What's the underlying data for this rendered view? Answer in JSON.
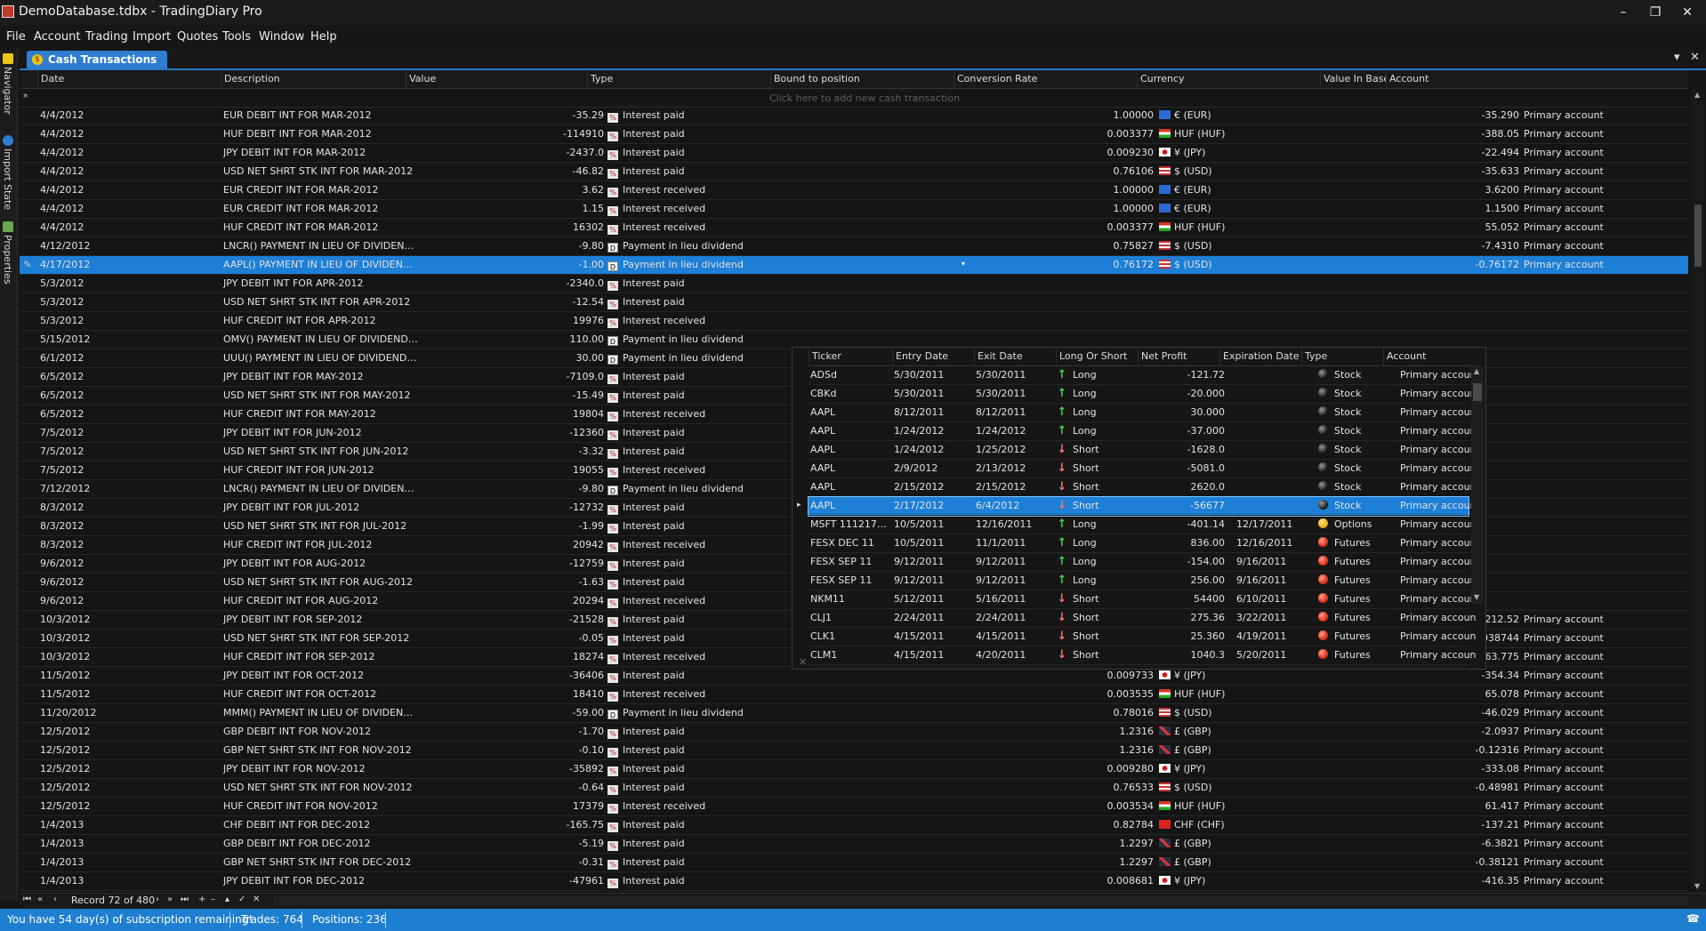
{
  "window": {
    "title": "DemoDatabase.tdbx - TradingDiary Pro",
    "controls": {
      "minimize": "–",
      "restore": "❐",
      "close": "✕"
    }
  },
  "menu": [
    "File",
    "Account",
    "Trading",
    "Import",
    "Quotes",
    "Tools",
    "Window",
    "Help"
  ],
  "side_tabs": [
    {
      "label": "Navigator",
      "icon": "navigator-icon"
    },
    {
      "label": "Import State",
      "icon": "info-icon"
    },
    {
      "label": "Properties",
      "icon": "properties-icon"
    }
  ],
  "document_tab": {
    "label": "Cash Transactions",
    "icon": "coin-icon",
    "dropdown_glyph": "▾",
    "close_glyph": "✕"
  },
  "grid": {
    "columns": [
      "Date",
      "Description",
      "Value",
      "Type",
      "Bound to position",
      "Conversion Rate",
      "Currency",
      "Value In Base",
      "Account"
    ],
    "new_row_marker": "*",
    "new_row_hint": "Click here to add new cash transaction",
    "editing_marker": "✎",
    "dropdown_glyph": "▾",
    "rows": [
      {
        "date": "4/4/2012",
        "description": "EUR DEBIT INT FOR MAR-2012",
        "value": "-35.29",
        "type": "Interest paid",
        "type_icon": "interest-paid-icon",
        "conversion_rate": "1.00000",
        "currency": "€ (EUR)",
        "flag": "eur",
        "value_in_base": "-35.290",
        "account": "Primary account"
      },
      {
        "date": "4/4/2012",
        "description": "HUF DEBIT INT FOR MAR-2012",
        "value": "-114910",
        "type": "Interest paid",
        "type_icon": "interest-paid-icon",
        "conversion_rate": "0.003377",
        "currency": "HUF (HUF)",
        "flag": "huf",
        "value_in_base": "-388.05",
        "account": "Primary account"
      },
      {
        "date": "4/4/2012",
        "description": "JPY DEBIT INT FOR MAR-2012",
        "value": "-2437.0",
        "type": "Interest paid",
        "type_icon": "interest-paid-icon",
        "conversion_rate": "0.009230",
        "currency": "¥ (JPY)",
        "flag": "jpy",
        "value_in_base": "-22.494",
        "account": "Primary account"
      },
      {
        "date": "4/4/2012",
        "description": "USD NET SHRT STK INT FOR MAR-2012",
        "value": "-46.82",
        "type": "Interest paid",
        "type_icon": "interest-paid-icon",
        "conversion_rate": "0.76106",
        "currency": "$ (USD)",
        "flag": "usd",
        "value_in_base": "-35.633",
        "account": "Primary account"
      },
      {
        "date": "4/4/2012",
        "description": "EUR CREDIT INT FOR MAR-2012",
        "value": "3.62",
        "type": "Interest received",
        "type_icon": "interest-received-icon",
        "conversion_rate": "1.00000",
        "currency": "€ (EUR)",
        "flag": "eur",
        "value_in_base": "3.6200",
        "account": "Primary account"
      },
      {
        "date": "4/4/2012",
        "description": "EUR CREDIT INT FOR MAR-2012",
        "value": "1.15",
        "type": "Interest received",
        "type_icon": "interest-received-icon",
        "conversion_rate": "1.00000",
        "currency": "€ (EUR)",
        "flag": "eur",
        "value_in_base": "1.1500",
        "account": "Primary account"
      },
      {
        "date": "4/4/2012",
        "description": "HUF CREDIT INT FOR MAR-2012",
        "value": "16302",
        "type": "Interest received",
        "type_icon": "interest-received-icon",
        "conversion_rate": "0.003377",
        "currency": "HUF (HUF)",
        "flag": "huf",
        "value_in_base": "55.052",
        "account": "Primary account"
      },
      {
        "date": "4/12/2012",
        "description": "LNCR() PAYMENT IN LIEU OF DIVIDEN…",
        "value": "-9.80",
        "type": "Payment in lieu dividend",
        "type_icon": "dividend-icon",
        "conversion_rate": "0.75827",
        "currency": "$ (USD)",
        "flag": "usd",
        "value_in_base": "-7.4310",
        "account": "Primary account"
      },
      {
        "date": "4/17/2012",
        "description": "AAPL() PAYMENT IN LIEU OF DIVIDEN…",
        "value": "-1.00",
        "type": "Payment in lieu dividend",
        "type_icon": "dividend-icon",
        "conversion_rate": "0.76172",
        "currency": "$ (USD)",
        "flag": "usd",
        "value_in_base": "-0.76172",
        "account": "Primary account",
        "selected": true
      },
      {
        "date": "5/3/2012",
        "description": "JPY DEBIT INT FOR APR-2012",
        "value": "-2340.0",
        "type": "Interest paid",
        "type_icon": "interest-paid-icon"
      },
      {
        "date": "5/3/2012",
        "description": "USD NET SHRT STK INT FOR APR-2012",
        "value": "-12.54",
        "type": "Interest paid",
        "type_icon": "interest-paid-icon"
      },
      {
        "date": "5/3/2012",
        "description": "HUF CREDIT INT FOR APR-2012",
        "value": "19976",
        "type": "Interest received",
        "type_icon": "interest-received-icon"
      },
      {
        "date": "5/15/2012",
        "description": "OMV() PAYMENT IN LIEU OF DIVIDEND…",
        "value": "110.00",
        "type": "Payment in lieu dividend",
        "type_icon": "dividend-icon"
      },
      {
        "date": "6/1/2012",
        "description": "UUU() PAYMENT IN LIEU OF DIVIDEND…",
        "value": "30.00",
        "type": "Payment in lieu dividend",
        "type_icon": "dividend-icon"
      },
      {
        "date": "6/5/2012",
        "description": "JPY DEBIT INT FOR MAY-2012",
        "value": "-7109.0",
        "type": "Interest paid",
        "type_icon": "interest-paid-icon"
      },
      {
        "date": "6/5/2012",
        "description": "USD NET SHRT STK INT FOR MAY-2012",
        "value": "-15.49",
        "type": "Interest paid",
        "type_icon": "interest-paid-icon"
      },
      {
        "date": "6/5/2012",
        "description": "HUF CREDIT INT FOR MAY-2012",
        "value": "19804",
        "type": "Interest received",
        "type_icon": "interest-received-icon"
      },
      {
        "date": "7/5/2012",
        "description": "JPY DEBIT INT FOR JUN-2012",
        "value": "-12360",
        "type": "Interest paid",
        "type_icon": "interest-paid-icon"
      },
      {
        "date": "7/5/2012",
        "description": "USD NET SHRT STK INT FOR JUN-2012",
        "value": "-3.32",
        "type": "Interest paid",
        "type_icon": "interest-paid-icon"
      },
      {
        "date": "7/5/2012",
        "description": "HUF CREDIT INT FOR JUN-2012",
        "value": "19055",
        "type": "Interest received",
        "type_icon": "interest-received-icon"
      },
      {
        "date": "7/12/2012",
        "description": "LNCR() PAYMENT IN LIEU OF DIVIDEN…",
        "value": "-9.80",
        "type": "Payment in lieu dividend",
        "type_icon": "dividend-icon"
      },
      {
        "date": "8/3/2012",
        "description": "JPY DEBIT INT FOR JUL-2012",
        "value": "-12732",
        "type": "Interest paid",
        "type_icon": "interest-paid-icon"
      },
      {
        "date": "8/3/2012",
        "description": "USD NET SHRT STK INT FOR JUL-2012",
        "value": "-1.99",
        "type": "Interest paid",
        "type_icon": "interest-paid-icon"
      },
      {
        "date": "8/3/2012",
        "description": "HUF CREDIT INT FOR JUL-2012",
        "value": "20942",
        "type": "Interest received",
        "type_icon": "interest-received-icon"
      },
      {
        "date": "9/6/2012",
        "description": "JPY DEBIT INT FOR AUG-2012",
        "value": "-12759",
        "type": "Interest paid",
        "type_icon": "interest-paid-icon"
      },
      {
        "date": "9/6/2012",
        "description": "USD NET SHRT STK INT FOR AUG-2012",
        "value": "-1.63",
        "type": "Interest paid",
        "type_icon": "interest-paid-icon"
      },
      {
        "date": "9/6/2012",
        "description": "HUF CREDIT INT FOR AUG-2012",
        "value": "20294",
        "type": "Interest received",
        "type_icon": "interest-received-icon"
      },
      {
        "date": "10/3/2012",
        "description": "JPY DEBIT INT FOR SEP-2012",
        "value": "-21528",
        "type": "Interest paid",
        "type_icon": "interest-paid-icon",
        "conversion_rate": "0.009872",
        "currency": "¥ (JPY)",
        "flag": "jpy",
        "value_in_base": "-212.52",
        "account": "Primary account"
      },
      {
        "date": "10/3/2012",
        "description": "USD NET SHRT STK INT FOR SEP-2012",
        "value": "-0.05",
        "type": "Interest paid",
        "type_icon": "interest-paid-icon",
        "conversion_rate": "0.77487",
        "currency": "$ (USD)",
        "flag": "usd",
        "value_in_base": "-0.038744",
        "account": "Primary account"
      },
      {
        "date": "10/3/2012",
        "description": "HUF CREDIT INT FOR SEP-2012",
        "value": "18274",
        "type": "Interest received",
        "type_icon": "interest-received-icon",
        "conversion_rate": "0.003490",
        "currency": "HUF (HUF)",
        "flag": "huf",
        "value_in_base": "63.775",
        "account": "Primary account"
      },
      {
        "date": "11/5/2012",
        "description": "JPY DEBIT INT FOR OCT-2012",
        "value": "-36406",
        "type": "Interest paid",
        "type_icon": "interest-paid-icon",
        "conversion_rate": "0.009733",
        "currency": "¥ (JPY)",
        "flag": "jpy",
        "value_in_base": "-354.34",
        "account": "Primary account"
      },
      {
        "date": "11/5/2012",
        "description": "HUF CREDIT INT FOR OCT-2012",
        "value": "18410",
        "type": "Interest received",
        "type_icon": "interest-received-icon",
        "conversion_rate": "0.003535",
        "currency": "HUF (HUF)",
        "flag": "huf",
        "value_in_base": "65.078",
        "account": "Primary account"
      },
      {
        "date": "11/20/2012",
        "description": "MMM() PAYMENT IN LIEU OF DIVIDEN…",
        "value": "-59.00",
        "type": "Payment in lieu dividend",
        "type_icon": "dividend-icon",
        "conversion_rate": "0.78016",
        "currency": "$ (USD)",
        "flag": "usd",
        "value_in_base": "-46.029",
        "account": "Primary account"
      },
      {
        "date": "12/5/2012",
        "description": "GBP DEBIT INT FOR NOV-2012",
        "value": "-1.70",
        "type": "Interest paid",
        "type_icon": "interest-paid-icon",
        "conversion_rate": "1.2316",
        "currency": "£ (GBP)",
        "flag": "gbp",
        "value_in_base": "-2.0937",
        "account": "Primary account"
      },
      {
        "date": "12/5/2012",
        "description": "GBP NET SHRT STK INT FOR NOV-2012",
        "value": "-0.10",
        "type": "Interest paid",
        "type_icon": "interest-paid-icon",
        "conversion_rate": "1.2316",
        "currency": "£ (GBP)",
        "flag": "gbp",
        "value_in_base": "-0.12316",
        "account": "Primary account"
      },
      {
        "date": "12/5/2012",
        "description": "JPY DEBIT INT FOR NOV-2012",
        "value": "-35892",
        "type": "Interest paid",
        "type_icon": "interest-paid-icon",
        "conversion_rate": "0.009280",
        "currency": "¥ (JPY)",
        "flag": "jpy",
        "value_in_base": "-333.08",
        "account": "Primary account"
      },
      {
        "date": "12/5/2012",
        "description": "USD NET SHRT STK INT FOR NOV-2012",
        "value": "-0.64",
        "type": "Interest paid",
        "type_icon": "interest-paid-icon",
        "conversion_rate": "0.76533",
        "currency": "$ (USD)",
        "flag": "usd",
        "value_in_base": "-0.48981",
        "account": "Primary account"
      },
      {
        "date": "12/5/2012",
        "description": "HUF CREDIT INT FOR NOV-2012",
        "value": "17379",
        "type": "Interest received",
        "type_icon": "interest-received-icon",
        "conversion_rate": "0.003534",
        "currency": "HUF (HUF)",
        "flag": "huf",
        "value_in_base": "61.417",
        "account": "Primary account"
      },
      {
        "date": "1/4/2013",
        "description": "CHF DEBIT INT FOR DEC-2012",
        "value": "-165.75",
        "type": "Interest paid",
        "type_icon": "interest-paid-icon",
        "conversion_rate": "0.82784",
        "currency": "CHF (CHF)",
        "flag": "chf",
        "value_in_base": "-137.21",
        "account": "Primary account"
      },
      {
        "date": "1/4/2013",
        "description": "GBP DEBIT INT FOR DEC-2012",
        "value": "-5.19",
        "type": "Interest paid",
        "type_icon": "interest-paid-icon",
        "conversion_rate": "1.2297",
        "currency": "£ (GBP)",
        "flag": "gbp",
        "value_in_base": "-6.3821",
        "account": "Primary account"
      },
      {
        "date": "1/4/2013",
        "description": "GBP NET SHRT STK INT FOR DEC-2012",
        "value": "-0.31",
        "type": "Interest paid",
        "type_icon": "interest-paid-icon",
        "conversion_rate": "1.2297",
        "currency": "£ (GBP)",
        "flag": "gbp",
        "value_in_base": "-0.38121",
        "account": "Primary account"
      },
      {
        "date": "1/4/2013",
        "description": "JPY DEBIT INT FOR DEC-2012",
        "value": "-47961",
        "type": "Interest paid",
        "type_icon": "interest-paid-icon",
        "conversion_rate": "0.008681",
        "currency": "¥ (JPY)",
        "flag": "jpy",
        "value_in_base": "-416.35",
        "account": "Primary account"
      }
    ]
  },
  "position_dropdown": {
    "columns": [
      "Ticker",
      "Entry Date",
      "Exit Date",
      "Long Or Short",
      "Net Profit",
      "Expiration Date",
      "Type",
      "Account"
    ],
    "current_row_marker": "▸",
    "close_glyph": "✕",
    "rows": [
      {
        "ticker": "ADSd",
        "entry": "5/30/2011",
        "exit": "5/30/2011",
        "direction": "Long",
        "dir_icon": "up",
        "profit": "-121.72",
        "expiration": "",
        "type": "Stock",
        "type_icon": "stock",
        "account": "Primary account"
      },
      {
        "ticker": "CBKd",
        "entry": "5/30/2011",
        "exit": "5/30/2011",
        "direction": "Long",
        "dir_icon": "up",
        "profit": "-20.000",
        "expiration": "",
        "type": "Stock",
        "type_icon": "stock",
        "account": "Primary account"
      },
      {
        "ticker": "AAPL",
        "entry": "8/12/2011",
        "exit": "8/12/2011",
        "direction": "Long",
        "dir_icon": "up",
        "profit": "30.000",
        "expiration": "",
        "type": "Stock",
        "type_icon": "stock",
        "account": "Primary account"
      },
      {
        "ticker": "AAPL",
        "entry": "1/24/2012",
        "exit": "1/24/2012",
        "direction": "Long",
        "dir_icon": "up",
        "profit": "-37.000",
        "expiration": "",
        "type": "Stock",
        "type_icon": "stock",
        "account": "Primary account"
      },
      {
        "ticker": "AAPL",
        "entry": "1/24/2012",
        "exit": "1/25/2012",
        "direction": "Short",
        "dir_icon": "down",
        "profit": "-1628.0",
        "expiration": "",
        "type": "Stock",
        "type_icon": "stock",
        "account": "Primary account"
      },
      {
        "ticker": "AAPL",
        "entry": "2/9/2012",
        "exit": "2/13/2012",
        "direction": "Short",
        "dir_icon": "down",
        "profit": "-5081.0",
        "expiration": "",
        "type": "Stock",
        "type_icon": "stock",
        "account": "Primary account"
      },
      {
        "ticker": "AAPL",
        "entry": "2/15/2012",
        "exit": "2/15/2012",
        "direction": "Short",
        "dir_icon": "down",
        "profit": "2620.0",
        "expiration": "",
        "type": "Stock",
        "type_icon": "stock",
        "account": "Primary account"
      },
      {
        "ticker": "AAPL",
        "entry": "2/17/2012",
        "exit": "6/4/2012",
        "direction": "Short",
        "dir_icon": "down",
        "profit": "-56677",
        "expiration": "",
        "type": "Stock",
        "type_icon": "stock",
        "account": "Primary account",
        "selected": true
      },
      {
        "ticker": "MSFT 111217…",
        "entry": "10/5/2011",
        "exit": "12/16/2011",
        "direction": "Long",
        "dir_icon": "up",
        "profit": "-401.14",
        "expiration": "12/17/2011",
        "type": "Options",
        "type_icon": "option",
        "account": "Primary account"
      },
      {
        "ticker": "FESX DEC 11",
        "entry": "10/5/2011",
        "exit": "11/1/2011",
        "direction": "Long",
        "dir_icon": "up",
        "profit": "836.00",
        "expiration": "12/16/2011",
        "type": "Futures",
        "type_icon": "future",
        "account": "Primary account"
      },
      {
        "ticker": "FESX SEP 11",
        "entry": "9/12/2011",
        "exit": "9/12/2011",
        "direction": "Long",
        "dir_icon": "up",
        "profit": "-154.00",
        "expiration": "9/16/2011",
        "type": "Futures",
        "type_icon": "future",
        "account": "Primary account"
      },
      {
        "ticker": "FESX SEP 11",
        "entry": "9/12/2011",
        "exit": "9/12/2011",
        "direction": "Long",
        "dir_icon": "up",
        "profit": "256.00",
        "expiration": "9/16/2011",
        "type": "Futures",
        "type_icon": "future",
        "account": "Primary account"
      },
      {
        "ticker": "NKM11",
        "entry": "5/12/2011",
        "exit": "5/16/2011",
        "direction": "Short",
        "dir_icon": "down",
        "profit": "54400",
        "expiration": "6/10/2011",
        "type": "Futures",
        "type_icon": "future",
        "account": "Primary account"
      },
      {
        "ticker": "CLJ1",
        "entry": "2/24/2011",
        "exit": "2/24/2011",
        "direction": "Short",
        "dir_icon": "down",
        "profit": "275.36",
        "expiration": "3/22/2011",
        "type": "Futures",
        "type_icon": "future",
        "account": "Primary account"
      },
      {
        "ticker": "CLK1",
        "entry": "4/15/2011",
        "exit": "4/15/2011",
        "direction": "Short",
        "dir_icon": "down",
        "profit": "25.360",
        "expiration": "4/19/2011",
        "type": "Futures",
        "type_icon": "future",
        "account": "Primary account"
      },
      {
        "ticker": "CLM1",
        "entry": "4/15/2011",
        "exit": "4/20/2011",
        "direction": "Short",
        "dir_icon": "down",
        "profit": "1040.3",
        "expiration": "5/20/2011",
        "type": "Futures",
        "type_icon": "future",
        "account": "Primary account"
      }
    ]
  },
  "navigator": {
    "record_label": "Record 72 of 480",
    "buttons": [
      "⏮",
      "«",
      "‹",
      "›",
      "»",
      "⏭",
      "+",
      "–",
      "▴",
      "✓",
      "✕"
    ]
  },
  "status": {
    "subscription": "You have 54 day(s) of subscription remaining!",
    "trades": "Trades: 764",
    "positions": "Positions: 236"
  },
  "colors": {
    "accent": "#1d7fd6",
    "background": "#161616",
    "text": "#e2e2e2",
    "status_bar": "#1e7fd0"
  }
}
